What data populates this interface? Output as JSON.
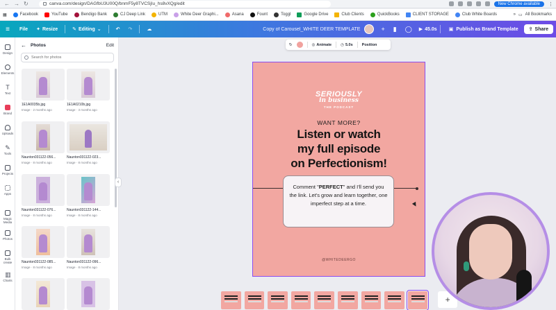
{
  "browser": {
    "url": "canva.com/design/DAGfbU3U00Q/bnmF5y8TVCSjIu_hs8vXQg/edit",
    "chrome_badge": "New Chrome available",
    "bookmarks": [
      "Facebook",
      "YouTube",
      "Bendigo Bank",
      "CJ Deep Link",
      "UTM",
      "White Deer Graphi...",
      "Asana",
      "Fount",
      "Toggl",
      "Google Drive",
      "Club Clients",
      "QuickBooks",
      "CLIENT STORAGE",
      "Club White Boards"
    ],
    "all_bookmarks": "All Bookmarks"
  },
  "topbar": {
    "file": "File",
    "resize": "Resize",
    "editing": "Editing",
    "doc_title": "Copy of Carousel_WHITE DEER TEMPLATE",
    "duration": "45.0s",
    "publish": "Publish as Brand Template",
    "share": "Share"
  },
  "rail": [
    "Design",
    "Elements",
    "Text",
    "Brand",
    "Uploads",
    "Tools",
    "Projects",
    "Apps",
    "Magic Media",
    "Photos",
    "Bulk create",
    "Charts"
  ],
  "panel": {
    "title": "Photos",
    "edit": "Edit",
    "search_placeholder": "Search for photos",
    "photos": [
      {
        "name": "1E1A0035b.jpg",
        "meta": "Image · 2 months ago"
      },
      {
        "name": "1E1A0210b.jpg",
        "meta": "Image · 3 months ago"
      },
      {
        "name": "Naunton031122-056...",
        "meta": "Image · 8 months ago"
      },
      {
        "name": "Naunton031122-023...",
        "meta": "Image · 8 months ago"
      },
      {
        "name": "Naunton031122-076...",
        "meta": "Image · 8 months ago"
      },
      {
        "name": "Naunton031122-144...",
        "meta": "Image · 8 months ago"
      },
      {
        "name": "Naunton031122-085...",
        "meta": "Image · 8 months ago"
      },
      {
        "name": "Naunton031122-096...",
        "meta": "Image · 8 months ago"
      },
      {
        "name": "",
        "meta": ""
      },
      {
        "name": "",
        "meta": ""
      }
    ]
  },
  "floatbar": {
    "animate": "Animate",
    "timing": "5.0s",
    "position": "Position"
  },
  "design": {
    "logo_line1": "SERIOUSLY",
    "logo_line2": "in business",
    "logo_line3": "THE PODCAST",
    "want_more": "WANT MORE?",
    "headline_1": "Listen or watch",
    "headline_2": "my full episode",
    "headline_3": "on Perfectionism!",
    "card_pre": "Comment \"",
    "card_bold": "PERFECT",
    "card_post": "\" and I'll send you the link. Let's grow and learn together, one imperfect step at a time.",
    "handle": "@WHITEDEERGO"
  },
  "filmstrip_count": 9,
  "colors": {
    "brand_gradient_start": "#08a7bd",
    "brand_gradient_end": "#6d4be6",
    "page_bg": "#f2a7a1",
    "selection": "#8a4cf0"
  }
}
